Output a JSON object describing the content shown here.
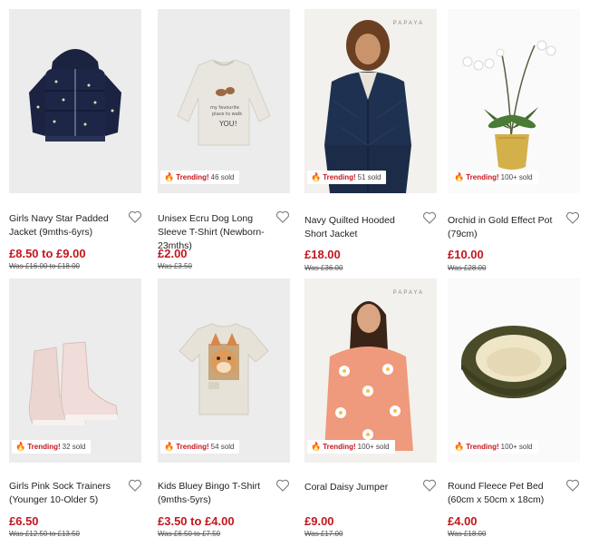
{
  "products": [
    {
      "name": "Girls Navy Star Padded Jacket (9mths-6yrs)",
      "price": "£8.50 to £9.00",
      "was": "Was £16.00 to £18.00",
      "badge": null,
      "image": "navy-padded-jacket-image"
    },
    {
      "name": "Unisex Ecru Dog Long Sleeve T-Shirt (Newborn-23mths)",
      "price": "£2.00",
      "was": "Was £3.50",
      "badge": {
        "trending": "Trending!",
        "sold": "46 sold"
      },
      "image": "dog-longsleeve-image"
    },
    {
      "name": "Navy Quilted Hooded Short Jacket",
      "price": "£18.00",
      "was": "Was £36.00",
      "badge": {
        "trending": "Trending!",
        "sold": "51 sold"
      },
      "brand": "PAPAYA",
      "image": "quilted-jacket-model-image"
    },
    {
      "name": "Orchid in Gold Effect Pot (79cm)",
      "price": "£10.00",
      "was": "Was £28.00",
      "badge": {
        "trending": "Trending!",
        "sold": "100+ sold"
      },
      "image": "orchid-pot-image"
    },
    {
      "name": "Girls Pink Sock Trainers (Younger 10-Older 5)",
      "price": "£6.50",
      "was": "Was £12.50 to £13.50",
      "badge": {
        "trending": "Trending!",
        "sold": "32 sold"
      },
      "image": "pink-sock-trainers-image"
    },
    {
      "name": "Kids Bluey Bingo T-Shirt (9mths-5yrs)",
      "price": "£3.50 to £4.00",
      "was": "Was £6.50 to £7.50",
      "badge": {
        "trending": "Trending!",
        "sold": "54 sold"
      },
      "image": "bluey-tshirt-image"
    },
    {
      "name": "Coral Daisy Jumper",
      "price": "£9.00",
      "was": "Was £17.00",
      "badge": {
        "trending": "Trending!",
        "sold": "100+ sold"
      },
      "brand": "PAPAYA",
      "image": "coral-daisy-jumper-model-image"
    },
    {
      "name": "Round Fleece Pet Bed (60cm x 50cm x 18cm)",
      "price": "£4.00",
      "was": "Was £18.00",
      "badge": {
        "trending": "Trending!",
        "sold": "100+ sold"
      },
      "image": "pet-bed-image"
    }
  ],
  "icons": {
    "wishlist": "heart-outline-icon",
    "trending": "fire-icon"
  },
  "colors": {
    "sale_price": "#c5161d",
    "trending": "#c5161d"
  }
}
